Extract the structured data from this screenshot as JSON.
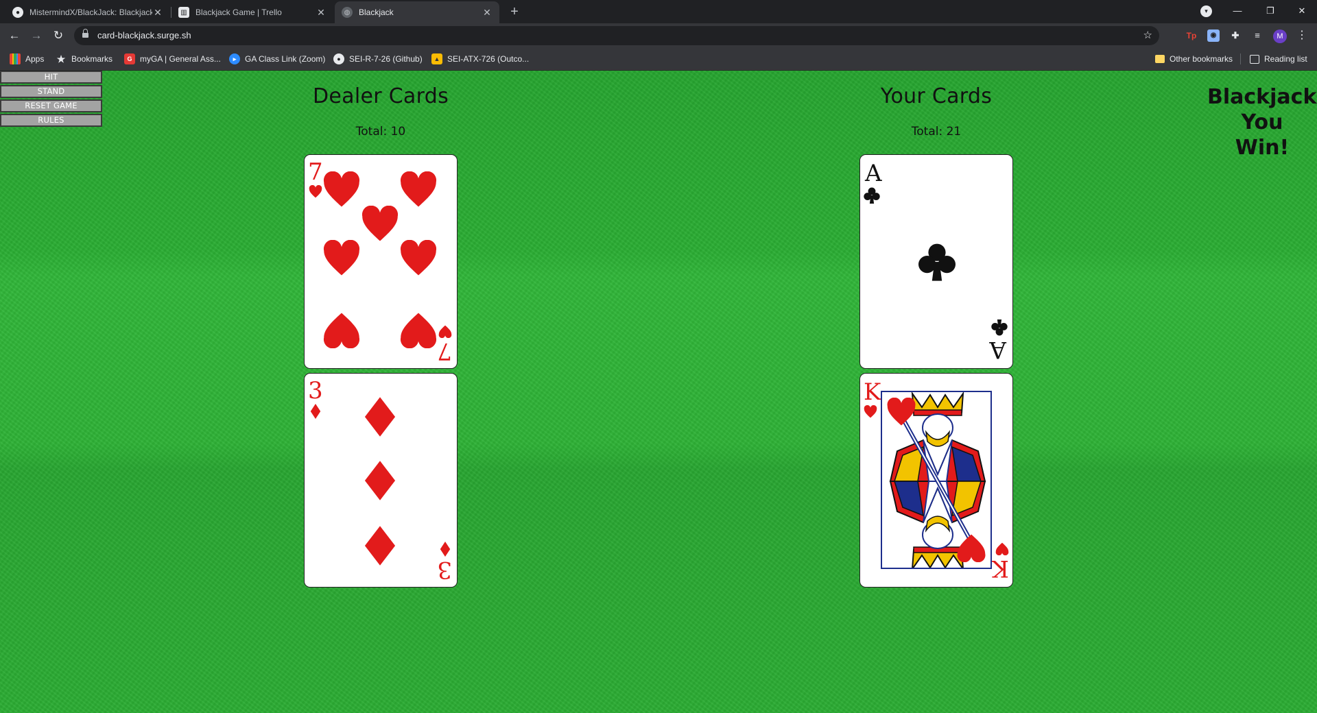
{
  "browser": {
    "tabs": [
      {
        "title": "MistermindX/BlackJack: Blackjack",
        "icon": "github-icon"
      },
      {
        "title": "Blackjack Game | Trello",
        "icon": "trello-icon"
      },
      {
        "title": "Blackjack",
        "icon": "globe-icon",
        "active": true
      }
    ],
    "url": "card-blackjack.surge.sh",
    "bookmarks": [
      {
        "label": "Apps"
      },
      {
        "label": "Bookmarks"
      },
      {
        "label": "myGA | General Ass..."
      },
      {
        "label": "GA Class Link (Zoom)"
      },
      {
        "label": "SEI-R-7-26 (Github)"
      },
      {
        "label": "SEI-ATX-726 (Outco..."
      }
    ],
    "other_bookmarks": "Other bookmarks",
    "reading_list": "Reading list",
    "profile_initial": "M"
  },
  "menu": {
    "hit": "HIT",
    "stand": "STAND",
    "reset": "RESET GAME",
    "rules": "RULES"
  },
  "dealer": {
    "heading": "Dealer Cards",
    "total": "Total: 10",
    "cards": [
      {
        "rank": "7",
        "suit": "hearts"
      },
      {
        "rank": "3",
        "suit": "diamonds"
      }
    ]
  },
  "player": {
    "heading": "Your Cards",
    "total": "Total: 21",
    "cards": [
      {
        "rank": "A",
        "suit": "clubs"
      },
      {
        "rank": "K",
        "suit": "hearts"
      }
    ]
  },
  "result": [
    "Blackjack!",
    "You",
    "Win!"
  ],
  "colors": {
    "felt": "#2bac33",
    "card_red": "#e21b1b",
    "card_black": "#111111",
    "button_bg": "#a3a3a3"
  }
}
